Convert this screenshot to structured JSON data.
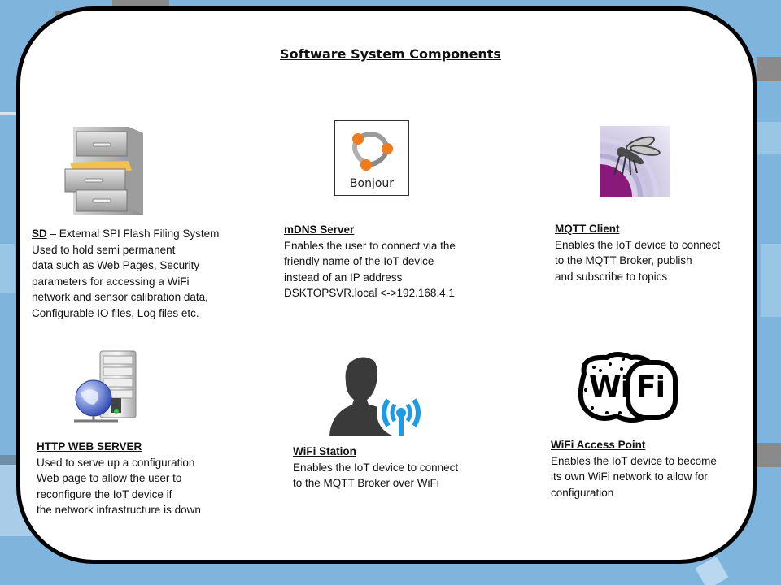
{
  "title": "Software System Components",
  "colors": {
    "background": "#7fb4dc",
    "card": "#ffffff",
    "border": "#000000",
    "wifi_blue": "#1e9be6",
    "mqtt_purple": "#8a1a7a"
  },
  "components": [
    {
      "id": "sd",
      "icon": "filing-cabinet-icon",
      "heading": "SD",
      "heading_suffix": " – External SPI Flash Filing System",
      "lines": [
        "Used to hold  semi permanent",
        "data such as Web Pages, Security",
        "parameters for accessing a WiFi",
        "network  and sensor calibration data,",
        "Configurable IO files, Log files etc."
      ]
    },
    {
      "id": "mdns",
      "icon": "bonjour-icon",
      "icon_label": "Bonjour",
      "heading": "mDNS Server",
      "lines": [
        "Enables the user to connect via the",
        "friendly name of the IoT device",
        "instead of an IP address",
        "DSKTOPSVR.local <->192.168.4.1"
      ]
    },
    {
      "id": "mqtt",
      "icon": "mosquitto-icon",
      "heading": "MQTT Client",
      "lines": [
        "Enables the IoT device to connect",
        "to the MQTT Broker, publish",
        "and subscribe to topics"
      ]
    },
    {
      "id": "http",
      "icon": "web-server-icon",
      "heading": "HTTP WEB SERVER",
      "lines": [
        "Used to serve up a configuration",
        "Web page to allow the user to",
        "reconfigure the IoT device if",
        "the network  infrastructure  is down"
      ]
    },
    {
      "id": "station",
      "icon": "user-antenna-icon",
      "heading": "WiFi Station",
      "lines": [
        "Enables the IoT device to connect",
        "to the  MQTT Broker  over WiFi"
      ]
    },
    {
      "id": "ap",
      "icon": "wifi-logo-icon",
      "icon_text_left": "Wi",
      "icon_text_right": "Fi",
      "heading": "WiFi Access Point",
      "lines": [
        "Enables the IoT device to become",
        "its own  WiFi network  to allow for",
        "configuration"
      ]
    }
  ]
}
